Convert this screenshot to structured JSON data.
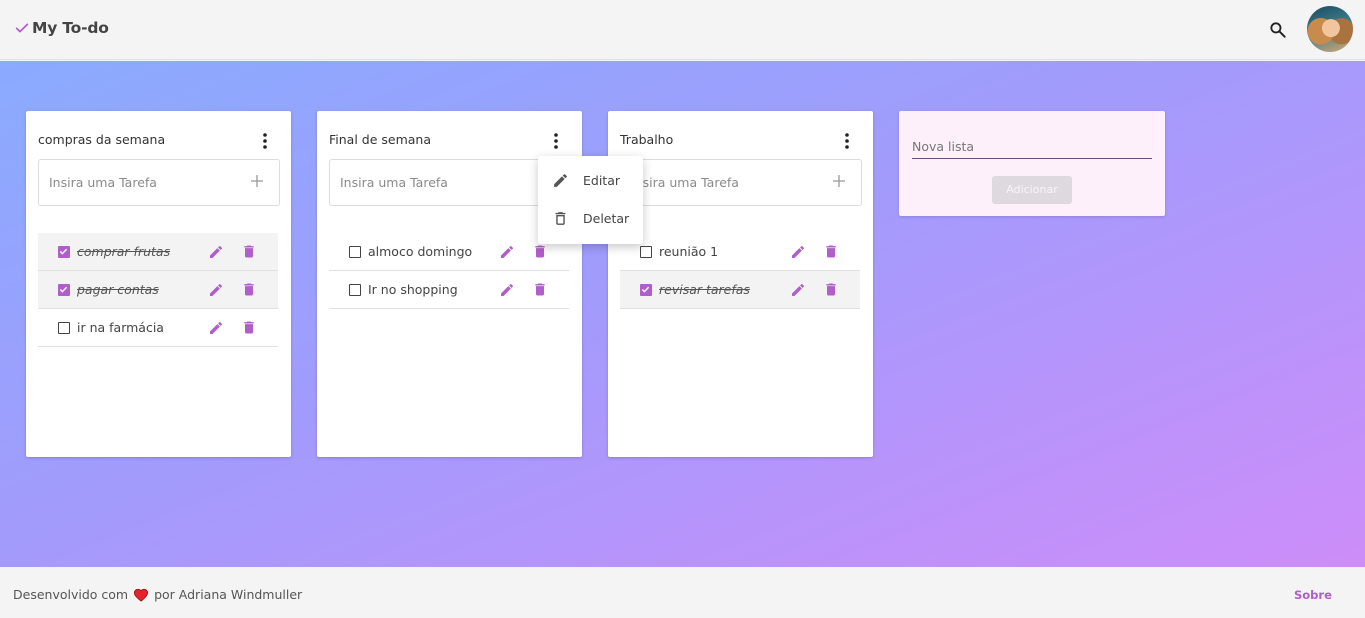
{
  "header": {
    "app_title": "My To-do",
    "logo_icon": "check-icon",
    "search_icon": "search-icon",
    "avatar_icon": "user-avatar"
  },
  "menu": {
    "items": [
      {
        "label": "Editar",
        "icon": "pencil-icon"
      },
      {
        "label": "Deletar",
        "icon": "trash-outline-icon"
      }
    ]
  },
  "lists": [
    {
      "title": "compras da semana",
      "placeholder": "Insira uma Tarefa",
      "tasks": [
        {
          "label": "comprar frutas",
          "done": true
        },
        {
          "label": "pagar contas",
          "done": true
        },
        {
          "label": "ir na farmácia",
          "done": false
        }
      ]
    },
    {
      "title": "Final de semana",
      "placeholder": "Insira uma Tarefa",
      "tasks": [
        {
          "label": "almoco domingo",
          "done": false
        },
        {
          "label": "Ir no shopping",
          "done": false
        }
      ]
    },
    {
      "title": "Trabalho",
      "placeholder": "Insira uma Tarefa",
      "tasks": [
        {
          "label": "reunião 1",
          "done": false
        },
        {
          "label": "revisar tarefas",
          "done": true
        }
      ]
    }
  ],
  "new_list": {
    "placeholder": "Nova lista",
    "button_label": "Adicionar"
  },
  "footer": {
    "credit_prefix": "Desenvolvido com",
    "credit_suffix": "por Adriana Windmuller",
    "about_link": "Sobre"
  },
  "colors": {
    "accent": "#b05ec9",
    "gradient_start": "#8aabff",
    "gradient_end": "#cd8df9",
    "heart": "#e8212b"
  }
}
